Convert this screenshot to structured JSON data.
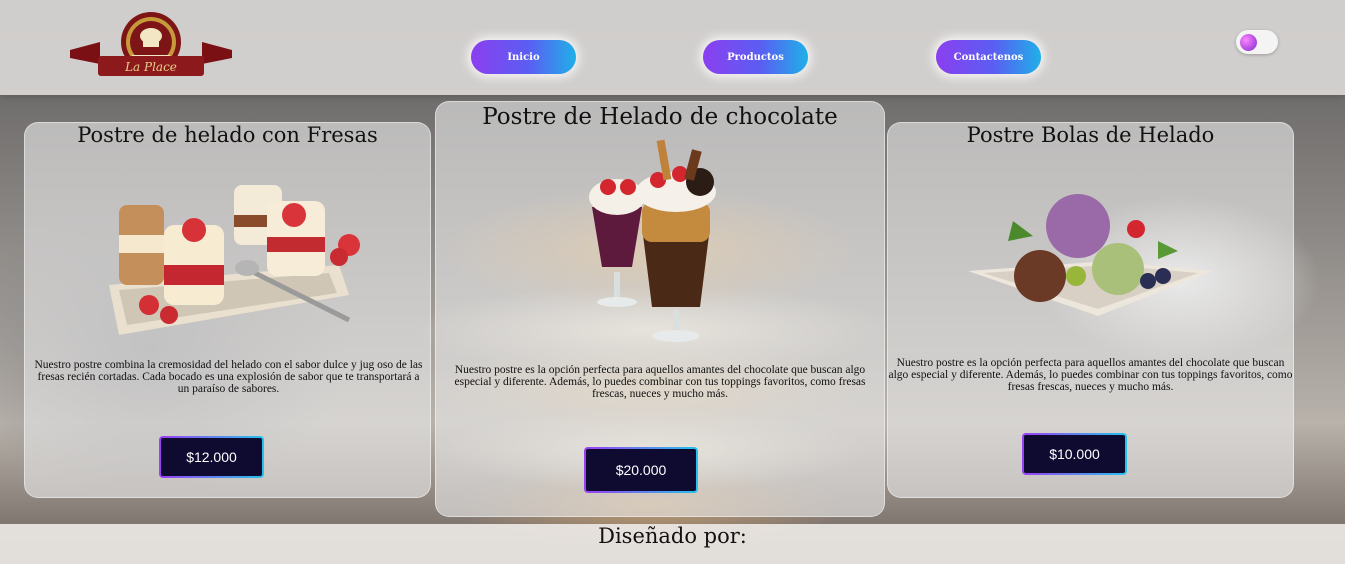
{
  "header": {
    "logo_text": "La Place",
    "nav": [
      "Inicio",
      "Productos",
      "Contactenos"
    ]
  },
  "products": [
    {
      "title": "Postre de helado con Fresas",
      "description": "Nuestro postre combina la cremosidad del helado con el sabor dulce y jug oso de las fresas recién cortadas. Cada bocado es una explosión de sabor que te transportará a un paraíso de sabores.",
      "price": "$12.000"
    },
    {
      "title": "Postre de Helado de chocolate",
      "description": "Nuestro postre es la opción perfecta para aquellos amantes del chocolate que buscan algo especial y diferente. Además, lo puedes combinar con tus toppings favoritos, como fresas frescas, nueces y mucho más.",
      "price": "$20.000"
    },
    {
      "title": "Postre Bolas de Helado",
      "description": "Nuestro postre es la opción perfecta para aquellos amantes del chocolate que buscan algo especial y diferente. Además, lo puedes combinar con tus toppings favoritos, como fresas frescas, nueces y mucho más.",
      "price": "$10.000"
    }
  ],
  "footer": {
    "title": "Diseñado por:"
  },
  "colors": {
    "nav_gradient_start": "#8b3ff0",
    "nav_gradient_end": "#1fb0e8",
    "price_button_bg": "#0e0a30"
  }
}
